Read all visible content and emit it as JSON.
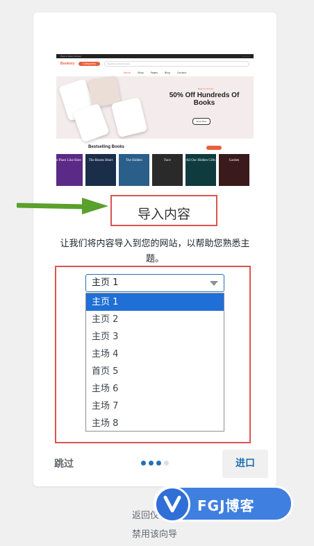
{
  "preview": {
    "topbar_left": "Free & Open Library",
    "logo": "Bookory",
    "category_btn": "Categories",
    "search_placeholder": "Search products here...",
    "nav": [
      "Home",
      "Shop",
      "Pages",
      "Blog",
      "Contact"
    ],
    "hero_kicker": "Back to School",
    "hero_title": "50% Off Hundreds Of Books",
    "hero_button": "Shop Now",
    "bestselling": "Bestselling Books",
    "covers": [
      {
        "title": "No Place Like Here",
        "color": "#5b2a86"
      },
      {
        "title": "The Beasts Heart",
        "color": "#1a2e4a"
      },
      {
        "title": "The Hidden",
        "color": "#2a5f8a"
      },
      {
        "title": "Face",
        "color": "#2a2a2a"
      },
      {
        "title": "All Our Hidden Gifts",
        "color": "#0f3b3e"
      },
      {
        "title": "Garden",
        "color": "#3a1a1a"
      }
    ]
  },
  "title": "导入内容",
  "description": "让我们将内容导入到您的网站，以帮助您熟悉主题。",
  "select": {
    "value": "主页 1",
    "options": [
      "主页 1",
      "主页 2",
      "主页 3",
      "主场 4",
      "首页 5",
      "主场 6",
      "主场 7",
      "主场 8"
    ]
  },
  "footer": {
    "skip": "跳过",
    "next": "进口",
    "steps_total": 4,
    "steps_done": 3
  },
  "links": {
    "back": "返回仪表盘",
    "disable": "禁用该向导"
  },
  "watermark": "FGJ博客",
  "colors": {
    "accent": "#2271b1",
    "annotation": "#d9534f",
    "arrow": "#5aa02c",
    "selected_option": "#1f6fd6"
  }
}
